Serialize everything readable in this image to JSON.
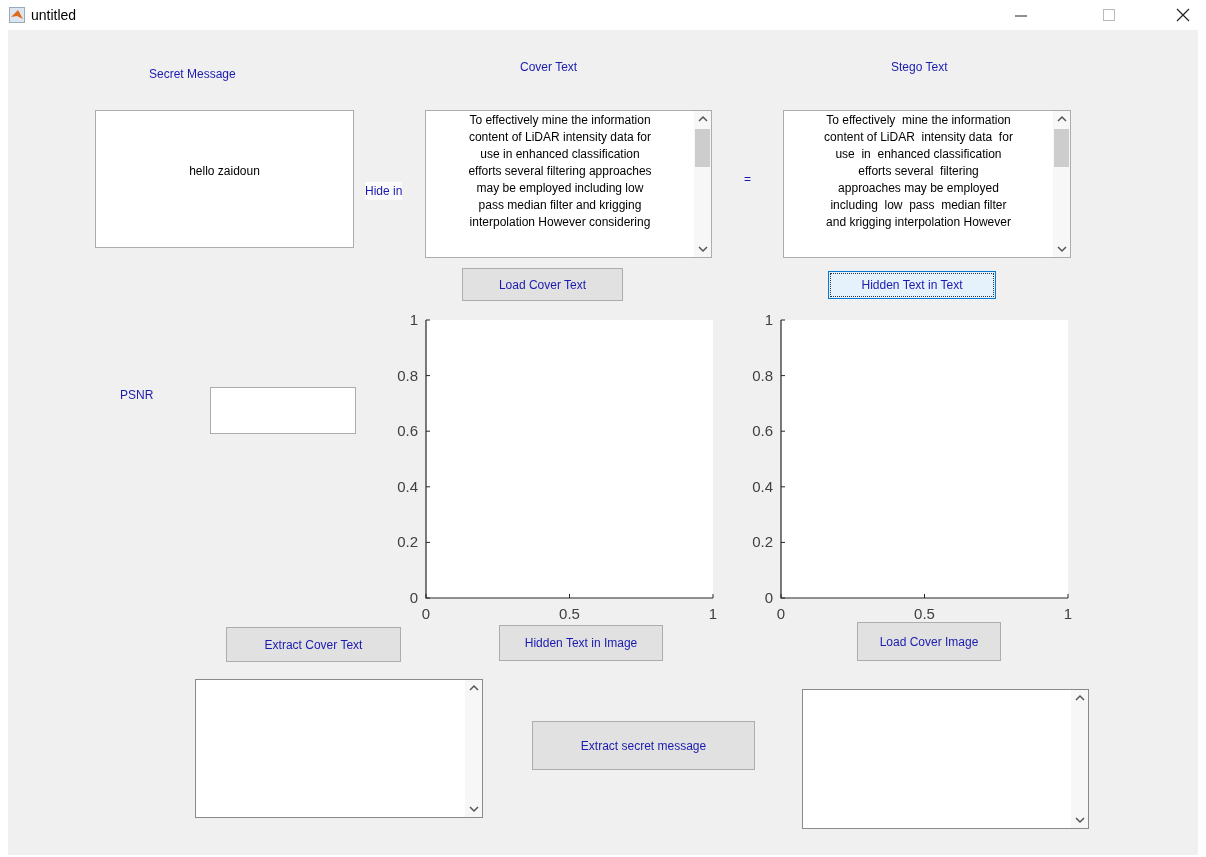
{
  "window": {
    "title": "untitled"
  },
  "labels": {
    "secret_message": "Secret Message",
    "cover_text": "Cover Text",
    "stego_text": "Stego Text",
    "hide_in": "Hide in",
    "equals": "=",
    "psnr": "PSNR"
  },
  "secret_message_field": {
    "value": "hello zaidoun"
  },
  "cover_text_box": {
    "value": "To effectively mine the information\ncontent of LiDAR intensity data for\nuse in enhanced classification\nefforts several filtering approaches\nmay be employed including low\npass median filter and krigging\ninterpolation However considering"
  },
  "stego_text_box": {
    "value": "To effectively  mine the information\ncontent of LiDAR  intensity data  for\nuse  in  enhanced classification\nefforts several  filtering\napproaches may be employed\nincluding  low  pass  median filter\nand krigging interpolation However"
  },
  "buttons": [
    {
      "label": "Load Cover Text",
      "focused": false
    },
    {
      "label": "Hidden Text in Text",
      "focused": true
    },
    {
      "label": "Extract Cover Text",
      "focused": false
    },
    {
      "label": "Hidden Text in Image",
      "focused": false
    },
    {
      "label": "Load Cover Image",
      "focused": false
    },
    {
      "label": "Extract  secret message",
      "focused": false
    }
  ],
  "axes": [
    {
      "chart_data": {
        "type": "line",
        "xlim": [
          0,
          1
        ],
        "ylim": [
          0,
          1
        ],
        "xticks": [
          {
            "value": 0,
            "label": "0"
          },
          {
            "value": 0.5,
            "label": "0.5"
          },
          {
            "value": 1,
            "label": "1"
          }
        ],
        "yticks": [
          {
            "value": 0,
            "label": "0"
          },
          {
            "value": 0.2,
            "label": "0.2"
          },
          {
            "value": 0.4,
            "label": "0.4"
          },
          {
            "value": 0.6,
            "label": "0.6"
          },
          {
            "value": 0.8,
            "label": "0.8"
          },
          {
            "value": 1,
            "label": "1"
          }
        ]
      }
    },
    {
      "chart_data": {
        "type": "line",
        "xlim": [
          0,
          1
        ],
        "ylim": [
          0,
          1
        ],
        "xticks": [
          {
            "value": 0,
            "label": "0"
          },
          {
            "value": 0.5,
            "label": "0.5"
          },
          {
            "value": 1,
            "label": "1"
          }
        ],
        "yticks": [
          {
            "value": 0,
            "label": "0"
          },
          {
            "value": 0.2,
            "label": "0.2"
          },
          {
            "value": 0.4,
            "label": "0.4"
          },
          {
            "value": 0.6,
            "label": "0.6"
          },
          {
            "value": 0.8,
            "label": "0.8"
          },
          {
            "value": 1,
            "label": "1"
          }
        ]
      }
    }
  ]
}
